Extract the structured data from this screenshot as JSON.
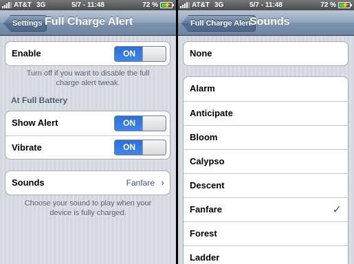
{
  "colors": {
    "accent": "#385487",
    "toggle_on": "#3f86e8",
    "nav": "#7d93ae"
  },
  "left": {
    "status": {
      "carrier": "AT&T",
      "network": "3G",
      "time": "5/7 - 11:48",
      "battery_pct": "72 %",
      "battery_level": 0.72
    },
    "nav": {
      "back_label": "Settings",
      "title": "Full Charge Alert"
    },
    "enable": {
      "label": "Enable",
      "toggle": "ON"
    },
    "enable_footnote": [
      "Turn off if you want to disable the full",
      "charge alert tweak."
    ],
    "section_header": "At Full Battery",
    "show_alert": {
      "label": "Show Alert",
      "toggle": "ON"
    },
    "vibrate": {
      "label": "Vibrate",
      "toggle": "ON"
    },
    "sounds": {
      "label": "Sounds",
      "value": "Fanfare",
      "chevron": "chevron-right-icon"
    },
    "sounds_footnote": [
      "Choose your sound to play when your",
      "device is fully charged."
    ]
  },
  "right": {
    "status": {
      "carrier": "AT&T",
      "network": "3G",
      "time": "5/7 - 11:48",
      "battery_pct": "72 %",
      "battery_level": 0.72
    },
    "nav": {
      "back_label": "Full Charge Alert",
      "title": "Sounds"
    },
    "none_label": "None",
    "sounds": [
      "Alarm",
      "Anticipate",
      "Bloom",
      "Calypso",
      "Descent",
      "Fanfare",
      "Forest",
      "Ladder"
    ],
    "selected": "Fanfare",
    "check_icon": "checkmark-icon"
  }
}
